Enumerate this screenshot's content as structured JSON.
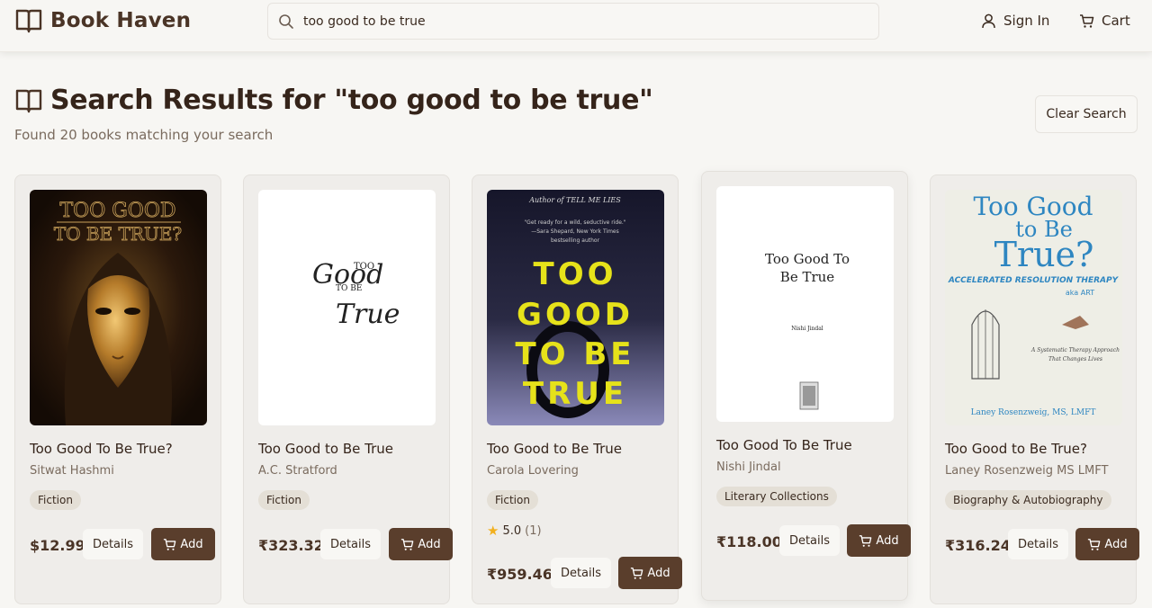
{
  "header": {
    "brand": "Book Haven",
    "search_value": "too good to be true",
    "sign_in_label": "Sign In",
    "cart_label": "Cart"
  },
  "results": {
    "title": "Search Results for \"too good to be true\"",
    "subtitle": "Found 20 books matching your search",
    "clear_label": "Clear Search"
  },
  "books": [
    {
      "title": "Too Good To Be True?",
      "author": "Sitwat Hashmi",
      "genre": "Fiction",
      "price": "$12.99",
      "details_label": "Details",
      "add_label": "Add",
      "cover": {
        "line1": "TOO GOOD",
        "line2": "TO BE TRUE?"
      }
    },
    {
      "title": "Too Good to Be True",
      "author": "A.C. Stratford",
      "genre": "Fiction",
      "price": "₹323.32",
      "details_label": "Details",
      "add_label": "Add",
      "cover": {
        "line1": "TOO",
        "line2": "Good",
        "line3": "TO BE",
        "line4": "True"
      }
    },
    {
      "title": "Too Good to Be True",
      "author": "Carola Lovering",
      "genre": "Fiction",
      "rating": "5.0",
      "rating_count": "(1)",
      "price": "₹959.46",
      "details_label": "Details",
      "add_label": "Add",
      "cover": {
        "top": "Author of TELL ME LIES",
        "quote": "\"Get ready for a wild, seductive ride.\"",
        "quote_by": "—Sara Shepard, New York Times",
        "quote_by2": "bestselling author",
        "w1": "TOO",
        "w2": "GOOD",
        "w3": "TO BE",
        "w4": "TRUE"
      }
    },
    {
      "title": "Too Good To Be True",
      "author": "Nishi Jindal",
      "genre": "Literary Collections",
      "price": "₹118.00",
      "details_label": "Details",
      "add_label": "Add",
      "cover": {
        "line1": "Too Good To",
        "line2": "Be True",
        "author": "Nishi Jindal"
      }
    },
    {
      "title": "Too Good to Be True?",
      "author": "Laney Rosenzweig MS LMFT",
      "genre": "Biography & Autobiography",
      "price": "₹316.24",
      "details_label": "Details",
      "add_label": "Add",
      "cover": {
        "l1": "Too Good",
        "l2": "to Be",
        "l3": "True?",
        "sub": "ACCELERATED RESOLUTION THERAPY",
        "aka": "aka ART",
        "tag1": "A Systematic Therapy Approach",
        "tag2": "That Changes Lives",
        "author": "Laney Rosenzweig, MS, LMFT"
      }
    }
  ]
}
